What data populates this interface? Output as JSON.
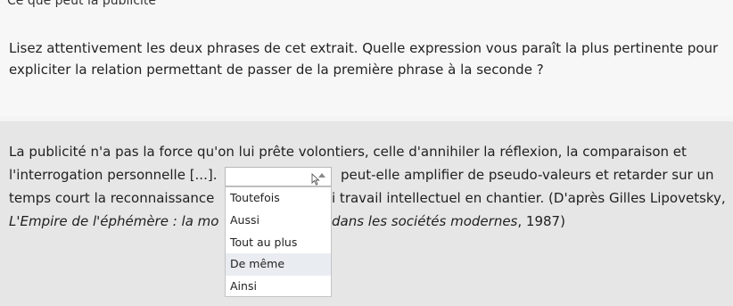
{
  "heading_partial": "Ce que peut la publicité",
  "question": "Lisez attentivement les deux phrases de cet extrait. Quelle expression vous paraît la plus pertinente pour expliciter la relation permettant de passer de la première phrase à la seconde ?",
  "passage": {
    "line1": "La publicité n'a pas la force qu'on lui prête volontiers, celle d'annihiler la réflexion, la comparaison et",
    "line2_start": "l'interrogation personnelle [...].",
    "line2_end": "peut-elle amplifier de pseudo-valeurs et retarder sur un",
    "line3_start": "temps court la reconnaissance",
    "line3_end": "i travail intellectuel en chantier. (D'après Gilles Lipovetsky,",
    "line4_start_italic": "L'Empire de l'éphémère : la mo",
    "line4_end_italic": "dans les sociétés modernes",
    "line4_end_rest": ", 1987)"
  },
  "dropdown": {
    "selected_value": "",
    "options": [
      "Toutefois",
      "Aussi",
      "Tout au plus",
      "De même",
      "Ainsi"
    ],
    "highlighted_index": 3
  },
  "colors": {
    "page_background": "#f4f4f4",
    "passage_background": "#e6e6e6",
    "option_hover": "#e9ecf1"
  },
  "icons": [
    "caret-up-icon",
    "mouse-cursor-icon"
  ]
}
